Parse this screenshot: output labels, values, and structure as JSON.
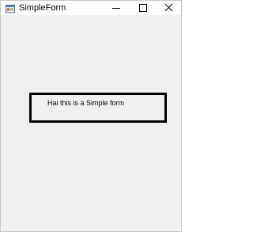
{
  "window": {
    "title": "SimpleForm",
    "icon": "winforms-app-icon",
    "controls": {
      "minimize_icon": "minimize-icon",
      "maximize_icon": "maximize-icon",
      "close_icon": "close-icon"
    }
  },
  "form": {
    "message": "Hai this is a Simple form"
  },
  "colors": {
    "client_background": "#f0f0f0",
    "titlebar_background": "#ffffff",
    "border": "#000000"
  }
}
